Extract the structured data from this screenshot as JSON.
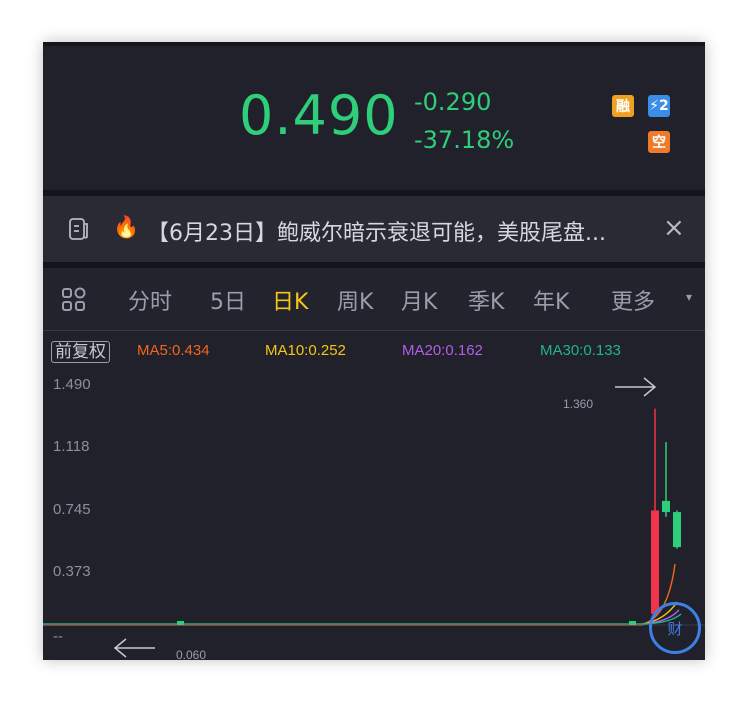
{
  "quote": {
    "price": "0.490",
    "change": "-0.290",
    "change_pct": "-37.18%",
    "color": "#2fce7b"
  },
  "badges": [
    {
      "label": "融",
      "color": "#f0a020"
    },
    {
      "label": "⚡2",
      "color": "#3b8ee6"
    },
    {
      "label": "空",
      "color": "#f07a2a"
    }
  ],
  "news": {
    "icon": "news-icon",
    "fire_icon": "fire-icon",
    "text": "【6月23日】鲍威尔暗示衰退可能，美股尾盘...",
    "close": "×"
  },
  "tabs": {
    "grid_icon": "grid-icon",
    "items": [
      "分时",
      "5日",
      "日K",
      "周K",
      "月K",
      "季K",
      "年K",
      "更多"
    ],
    "active": "日K",
    "more_arrow": "▾"
  },
  "legend": {
    "adjust": "前复权",
    "ma5": "MA5:0.434",
    "ma10": "MA10:0.252",
    "ma20": "MA20:0.162",
    "ma30": "MA30:0.133",
    "colors": {
      "ma5": "#f5651a",
      "ma10": "#f5c518",
      "ma20": "#b25ee8",
      "ma30": "#1fb58f"
    }
  },
  "y_axis": [
    "1.490",
    "1.118",
    "0.745",
    "0.373",
    "--"
  ],
  "markers": {
    "high": "1.360",
    "low": "0.060"
  },
  "finance_badge": "财",
  "chart_data": {
    "type": "candlestick",
    "ylim": [
      0,
      1.49
    ],
    "y_ticks": [
      1.49,
      1.118,
      0.745,
      0.373
    ],
    "up_color": "#f2334a",
    "down_color": "#2fce7b",
    "high_marker": 1.36,
    "low_marker": 0.06,
    "candles": [
      {
        "open": 0.07,
        "close": 0.72,
        "high": 1.36,
        "low": 0.06
      },
      {
        "open": 0.78,
        "close": 0.71,
        "high": 1.15,
        "low": 0.68
      },
      {
        "open": 0.71,
        "close": 0.49,
        "high": 0.72,
        "low": 0.48
      }
    ]
  }
}
